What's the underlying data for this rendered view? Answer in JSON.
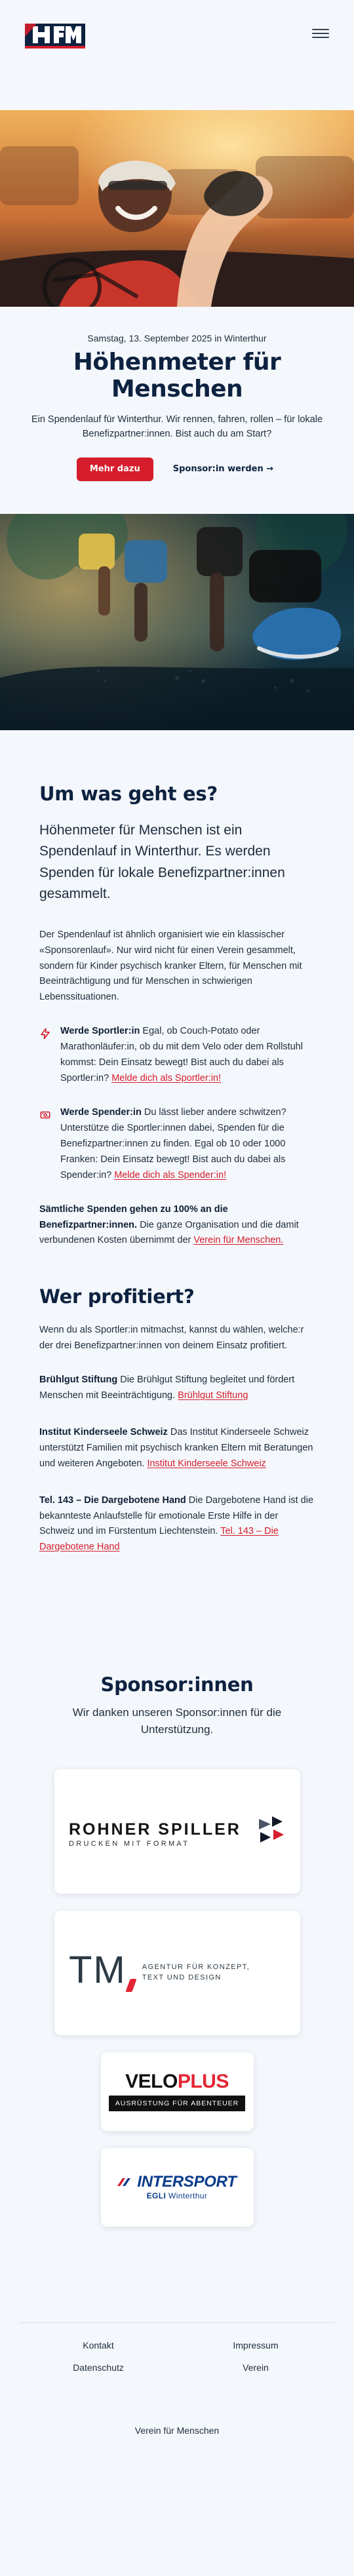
{
  "header": {
    "logo_alt": "HfM",
    "menu_icon": "hamburger-icon"
  },
  "hero": {
    "date": "Samstag, 13. September 2025 in Winterthur",
    "title": "Höhenmeter für Menschen",
    "description": "Ein Spendenlauf für Winterthur. Wir rennen, fahren, rollen – für lokale Benefizpartner:innen. Bist auch du am Start?",
    "primary_button": "Mehr dazu",
    "secondary_button": "Sponsor:in werden →"
  },
  "about": {
    "title": "Um was geht es?",
    "lead": "Höhenmeter für Menschen ist ein Spendenlauf in Winterthur. Es werden Spenden für lokale Benefizpartner:innen gesammelt.",
    "paragraph": "Der Spendenlauf ist ähnlich organisiert wie ein klassischer «Sponsorenlauf». Nur wird nicht für einen Verein gesammelt, sondern für Kinder psychisch kranker Eltern, für Menschen mit Beeinträchtigung und für Menschen in schwierigen Lebenssituationen.",
    "feature_1": {
      "icon": "lightning-icon",
      "strong": "Werde Sportler:in",
      "text": " Egal, ob Couch-Potato oder Marathonläufer:in, ob du mit dem Velo oder dem Rollstuhl kommst: Dein Einsatz bewegt! Bist auch du dabei als Sportler:in?",
      "link": "Melde dich als Sportler:in!"
    },
    "feature_2": {
      "icon": "money-icon",
      "strong": "Werde Spender:in",
      "text": " Du lässt lieber andere schwitzen? Unterstütze die Sportler:innen dabei, Spenden für die Benefizpartner:innen zu finden. Egal ob 10 oder 1000 Franken: Dein Einsatz bewegt! Bist auch du dabei als Spender:in?",
      "link": "Melde dich als Spender:in!"
    },
    "note_strong": "Sämtliche Spenden gehen zu 100% an die Benefizpartner:innen.",
    "note_text": " Die ganze Organisation und die damit verbundenen Kosten übernimmt der ",
    "note_link": "Verein für Menschen."
  },
  "beneficiaries": {
    "title": "Wer profitiert?",
    "intro": "Wenn du als Sportler:in mitmachst, kannst du wählen, welche:r der drei Benefizpartner:innen von deinem Einsatz profitiert.",
    "items": [
      {
        "name": "Brühlgut Stiftung",
        "text": " Die Brühlgut Stiftung begleitet und fördert Menschen mit Beeinträchtigung. ",
        "link": "Brühlgut Stiftung"
      },
      {
        "name": "Institut Kinderseele Schweiz",
        "text": " Das Institut Kinderseele Schweiz unterstützt Familien mit psychisch kranken Eltern mit Beratungen und weiteren Angeboten. ",
        "link": "Institut Kinderseele Schweiz"
      },
      {
        "name": "Tel. 143 – Die Dargebotene Hand",
        "text": " Die Dargebotene Hand ist die bekannteste Anlaufstelle für emotionale Erste Hilfe in der Schweiz und im Fürstentum Liechtenstein. ",
        "link": "Tel. 143 – Die Dargebotene Hand"
      }
    ]
  },
  "sponsors": {
    "title": "Sponsor:innen",
    "subtitle": "Wir danken unseren Sponsor:innen für die Unterstützung.",
    "rohner": {
      "title": "ROHNER SPILLER",
      "subtitle": "DRUCKEN MIT FORMAT"
    },
    "tm": {
      "mark": "TM",
      "line1": "AGENTUR FÜR KONZEPT,",
      "line2": "TEXT UND DESIGN"
    },
    "veloplus": {
      "velo": "VELO",
      "plus": "PLUS",
      "bar": "AUSRÜSTUNG FÜR ABENTEUER"
    },
    "intersport": {
      "title": "INTERSPORT",
      "egli": "EGLI",
      "place": " Winterthur"
    }
  },
  "footer": {
    "links": [
      "Kontakt",
      "Impressum",
      "Datenschutz",
      "Verein"
    ],
    "bottom": "Verein für Menschen"
  },
  "colors": {
    "accent": "#d61d2b",
    "navy": "#0d2240",
    "background": "#f4f7fb"
  }
}
